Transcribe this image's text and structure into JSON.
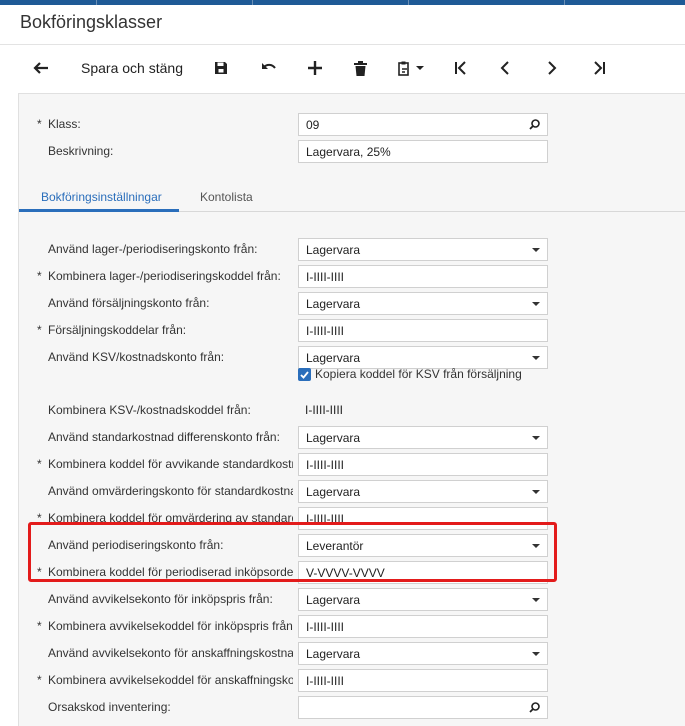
{
  "title": "Bokföringsklasser",
  "toolbar": {
    "back_icon": "arrow-left-icon",
    "save_close_label": "Spara och stäng",
    "save_icon": "floppy-disk-icon",
    "undo_icon": "undo-icon",
    "add_icon": "plus-icon",
    "delete_icon": "trash-icon",
    "clipboard_icon": "clipboard-icon",
    "first_icon": "first-page-icon",
    "prev_icon": "chevron-left-icon",
    "next_icon": "chevron-right-icon",
    "last_icon": "last-page-icon"
  },
  "header": {
    "class_label": "Klass:",
    "class_value": "09",
    "description_label": "Beskrivning:",
    "description_value": "Lagervara, 25%"
  },
  "tabs": [
    {
      "label": "Bokföringsinställningar",
      "active": true
    },
    {
      "label": "Kontolista",
      "active": false
    }
  ],
  "rows": [
    {
      "label": "Använd lager-/periodiseringskonto från:",
      "value": "Lagervara",
      "required": false,
      "kind": "select"
    },
    {
      "label": "Kombinera lager-/periodiseringskoddel från:",
      "value": "I-IIII-IIII",
      "required": true,
      "kind": "input"
    },
    {
      "label": "Använd försäljningskonto från:",
      "value": "Lagervara",
      "required": false,
      "kind": "select"
    },
    {
      "label": "Försäljningskoddelar från:",
      "value": "I-IIII-IIII",
      "required": true,
      "kind": "input"
    },
    {
      "label": "Använd KSV/kostnadskonto från:",
      "value": "Lagervara",
      "required": false,
      "kind": "select"
    },
    {
      "label": "Kombinera KSV-/kostnadskoddel från:",
      "value": "I-IIII-IIII",
      "required": false,
      "kind": "plain"
    },
    {
      "label": "Använd standarkostnad differenskonto från:",
      "value": "Lagervara",
      "required": false,
      "kind": "select"
    },
    {
      "label": "Kombinera koddel för avvikande standardkostnad från:",
      "value": "I-IIII-IIII",
      "required": true,
      "kind": "input"
    },
    {
      "label": "Använd omvärderingskonto för standardkostnad från:",
      "value": "Lagervara",
      "required": false,
      "kind": "select"
    },
    {
      "label": "Kombinera koddel för omvärdering av standardkostnad från:",
      "value": "I-IIII-IIII",
      "required": true,
      "kind": "input"
    },
    {
      "label": "Använd periodiseringskonto från:",
      "value": "Leverantör",
      "required": false,
      "kind": "select"
    },
    {
      "label": "Kombinera koddel för periodiserad inköpsorder från:",
      "value": "V-VVVV-VVVV",
      "required": true,
      "kind": "input"
    },
    {
      "label": "Använd avvikelsekonto för inköpspris från:",
      "value": "Lagervara",
      "required": false,
      "kind": "select"
    },
    {
      "label": "Kombinera avvikelsekoddel för inköpspris från:",
      "value": "I-IIII-IIII",
      "required": true,
      "kind": "input"
    },
    {
      "label": "Använd avvikelsekonto för anskaffningskostnad från:",
      "value": "Lagervara",
      "required": false,
      "kind": "select"
    },
    {
      "label": "Kombinera avvikelsekoddel för anskaffningskostnad från:",
      "value": "I-IIII-IIII",
      "required": true,
      "kind": "input"
    },
    {
      "label": "Orsakskod inventering:",
      "value": "",
      "required": false,
      "kind": "lookup"
    }
  ],
  "checkbox": {
    "label": "Kopiera koddel för KSV från försäljning",
    "checked": true
  },
  "colors": {
    "accent": "#2a6ebb",
    "highlight": "#e31b1b",
    "topbar": "#1f5a96"
  }
}
